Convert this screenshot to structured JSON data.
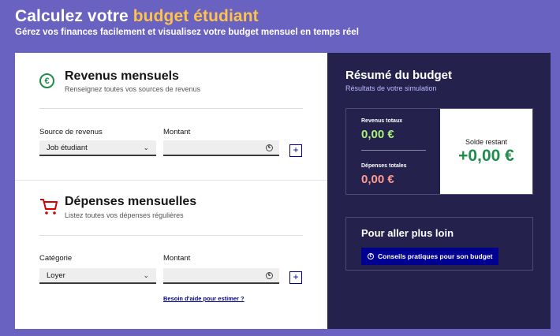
{
  "hero": {
    "title_prefix": "Calculez votre ",
    "title_accent": "budget étudiant",
    "subtitle": "Gérez vos finances facilement et visualisez votre budget mensuel en temps réel"
  },
  "income": {
    "title": "Revenus mensuels",
    "subtitle": "Renseignez toutes vos sources de revenus",
    "source_label": "Source de revenus",
    "source_value": "Job étudiant",
    "amount_label": "Montant",
    "amount_value": "",
    "add_label": "+"
  },
  "expenses": {
    "title": "Dépenses mensuelles",
    "subtitle": "Listez toutes vos dépenses régulières",
    "category_label": "Catégorie",
    "category_value": "Loyer",
    "amount_label": "Montant",
    "amount_value": "",
    "add_label": "+",
    "help_link": "Besoin d'aide pour estimer ?"
  },
  "summary": {
    "title": "Résumé du budget",
    "subtitle": "Résultats de votre simulation",
    "income_total_label": "Revenus totaux",
    "income_total_value": "0,00 €",
    "expense_total_label": "Dépenses totales",
    "expense_total_value": "0,00 €",
    "balance_label": "Solde restant",
    "balance_value": "+0,00 €"
  },
  "more": {
    "title": "Pour aller plus loin",
    "button_label": "Conseils pratiques pour son budget"
  },
  "colors": {
    "background": "#6a62c1",
    "accent": "#ffc24a",
    "summary_bg": "#24224d",
    "income_green": "#a8f27a",
    "expense_red": "#ff9b8f",
    "balance_green": "#1f8d49",
    "primary_blue": "#000091"
  }
}
